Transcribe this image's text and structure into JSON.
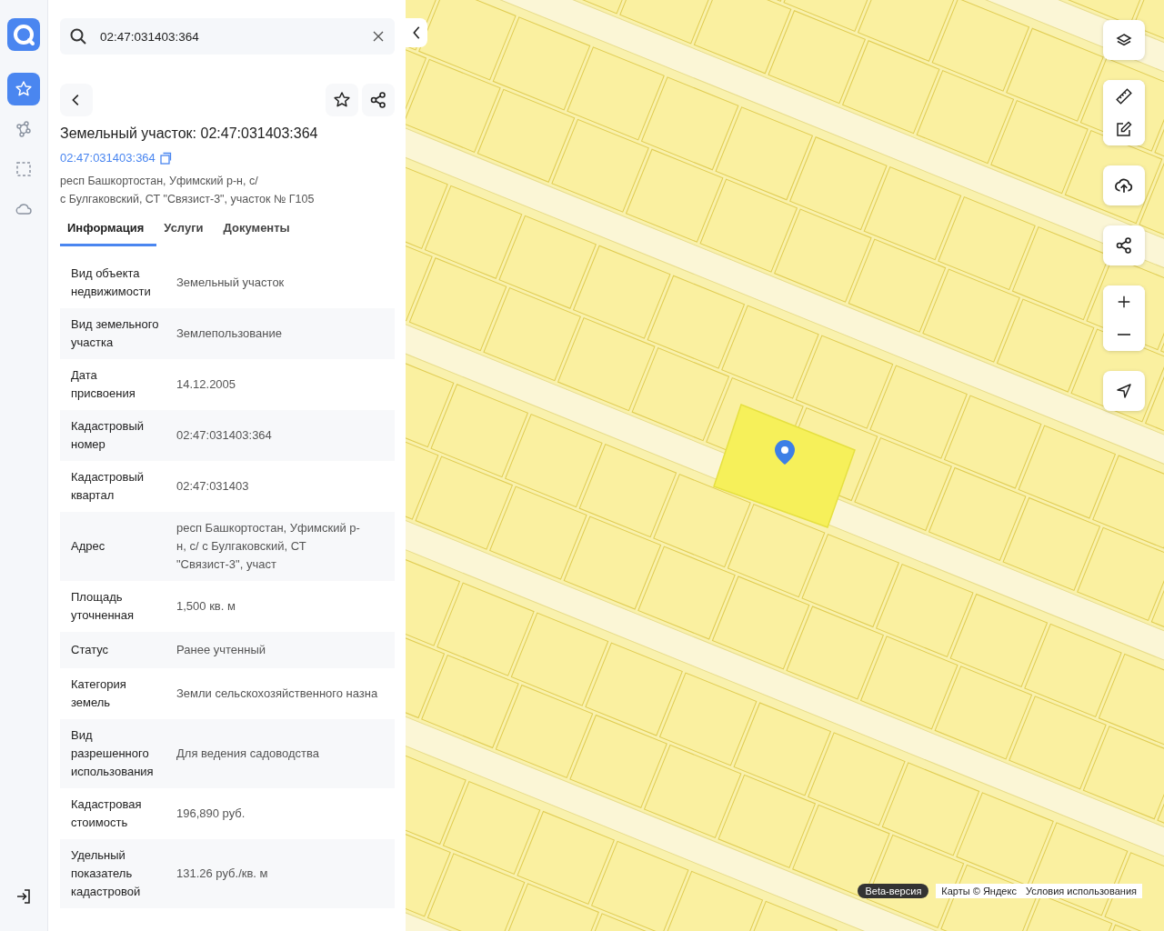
{
  "rail": {
    "items": [
      {
        "kind": "favorites",
        "selected": true
      },
      {
        "kind": "polygon",
        "selected": false
      },
      {
        "kind": "select",
        "selected": false
      },
      {
        "kind": "cloud",
        "selected": false
      }
    ]
  },
  "search": {
    "value": "02:47:031403:364"
  },
  "object": {
    "title": "Земельный участок: 02:47:031403:364",
    "number_link": "02:47:031403:364",
    "address_lines": [
      "респ Башкортостан, Уфимский р-н, с/",
      "с Булгаковский, СТ \"Связист-3\", участок № Г105"
    ]
  },
  "tabs": [
    {
      "label": "Информация",
      "selected": true
    },
    {
      "label": "Услуги",
      "selected": false
    },
    {
      "label": "Документы",
      "selected": false
    }
  ],
  "rows": [
    {
      "label": "Вид объекта недвижимости",
      "value": "Земельный участок"
    },
    {
      "label": "Вид земельного участка",
      "value": "Землепользование"
    },
    {
      "label": "Дата присвоения",
      "value": "14.12.2005"
    },
    {
      "label": "Кадастровый номер",
      "value": "02:47:031403:364"
    },
    {
      "label": "Кадастровый квартал",
      "value": "02:47:031403"
    },
    {
      "label": "Адрес",
      "value": "респ Башкортостан, Уфимский р-н, с/ с Булгаковский, СТ \"Связист-3\", участ"
    },
    {
      "label": "Площадь уточненная",
      "value": "1,500 кв. м"
    },
    {
      "label": "Статус",
      "value": "Ранее учтенный"
    },
    {
      "label": "Категория земель",
      "value": "Земли сельскохозяйственного назна"
    },
    {
      "label": "Вид разрешенного использования",
      "value": "Для ведения садоводства"
    },
    {
      "label": "Кадастровая стоимость",
      "value": "196,890 руб."
    },
    {
      "label": "Удельный показатель кадастровой",
      "value": "131.26 руб./кв. м"
    }
  ],
  "map": {
    "beta_badge": "Beta-версия",
    "attribution": "Карты © Яндекс",
    "terms_link": "Условия использования"
  }
}
